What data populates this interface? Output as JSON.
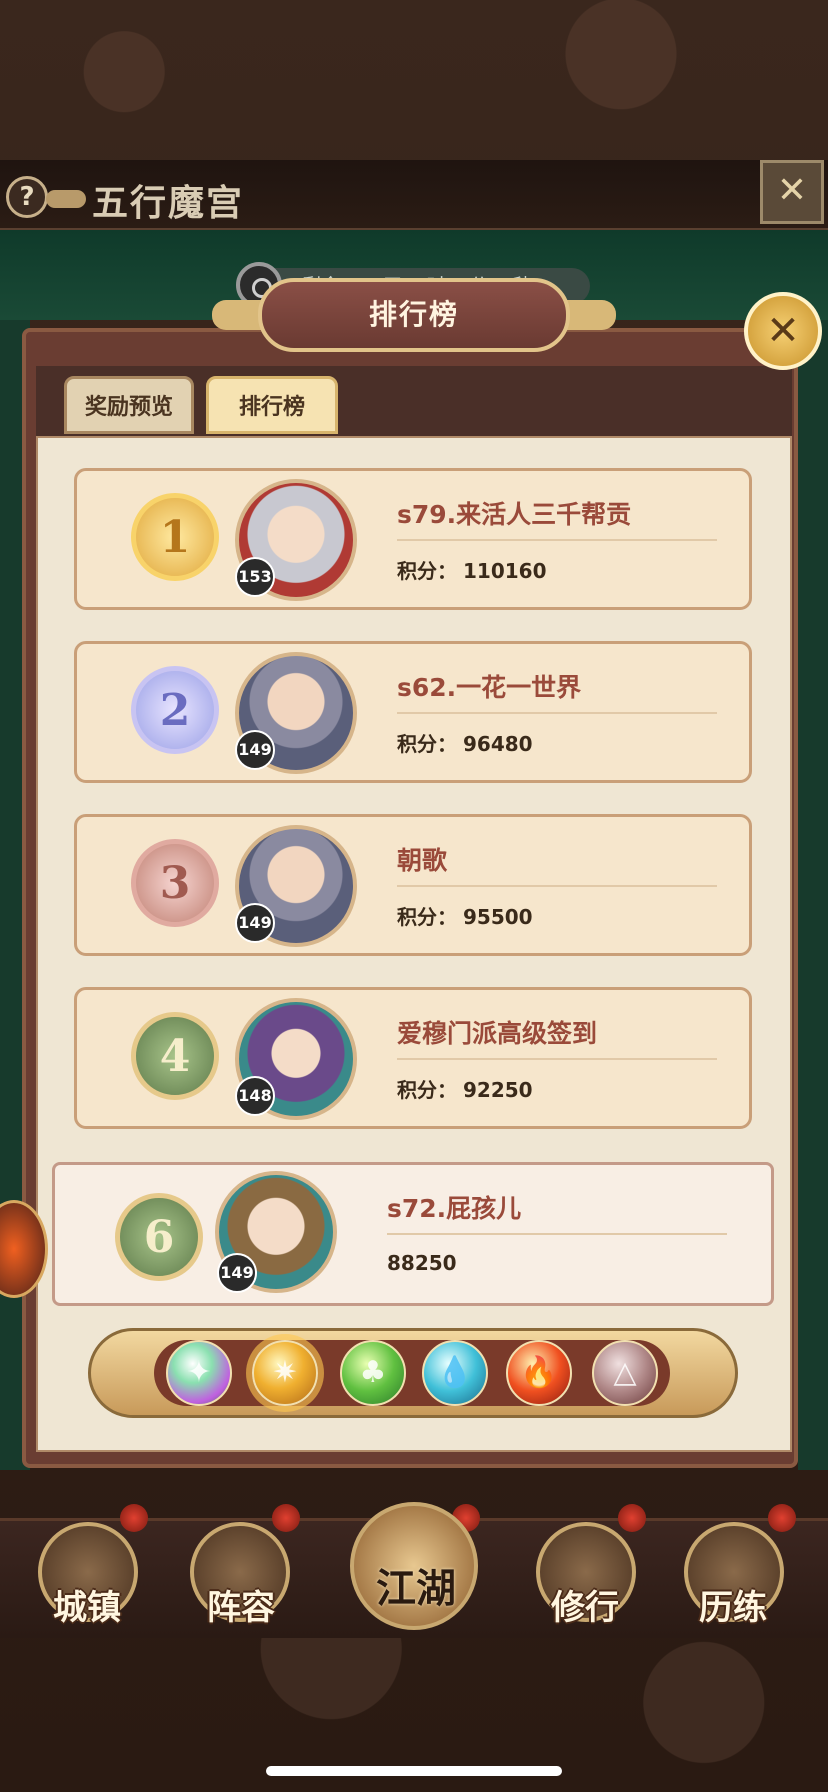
{
  "window": {
    "title": "五行魔宫",
    "help_glyph": "?"
  },
  "timer": {
    "text": "剩余：11天20时52分38秒"
  },
  "panel": {
    "title": "排行榜"
  },
  "tabs": [
    {
      "label": "奖励预览",
      "active": false
    },
    {
      "label": "排行榜",
      "active": true
    }
  ],
  "rankings": [
    {
      "rank": "1",
      "name": "s79.来活人三千帮贡",
      "score_label": "积分：",
      "score": "110160",
      "level": "153",
      "medal": "gold"
    },
    {
      "rank": "2",
      "name": "s62.一花一世界",
      "score_label": "积分：",
      "score": "96480",
      "level": "149",
      "medal": "silver"
    },
    {
      "rank": "3",
      "name": "朝歌",
      "score_label": "积分：",
      "score": "95500",
      "level": "149",
      "medal": "bronze"
    },
    {
      "rank": "4",
      "name": "爱穆门派高级签到",
      "score_label": "积分：",
      "score": "92250",
      "level": "148",
      "medal": "green"
    }
  ],
  "self_rank": {
    "rank": "6",
    "name": "s72.屁孩儿",
    "score": "88250",
    "level": "149"
  },
  "elements": [
    {
      "icon": "chaos-orb-icon",
      "glyph": "✦"
    },
    {
      "icon": "metal-orb-icon",
      "glyph": "✷",
      "selected": true
    },
    {
      "icon": "wood-orb-icon",
      "glyph": "♣"
    },
    {
      "icon": "water-orb-icon",
      "glyph": "💧"
    },
    {
      "icon": "fire-orb-icon",
      "glyph": "🔥"
    },
    {
      "icon": "earth-orb-icon",
      "glyph": "△"
    }
  ],
  "nav": [
    {
      "label": "城镇"
    },
    {
      "label": "阵容"
    },
    {
      "label": "江湖"
    },
    {
      "label": "修行"
    },
    {
      "label": "历练"
    }
  ],
  "colors": {
    "accent": "#9a4a3a",
    "paper": "#efe6d3",
    "panel": "#6a3d32"
  }
}
